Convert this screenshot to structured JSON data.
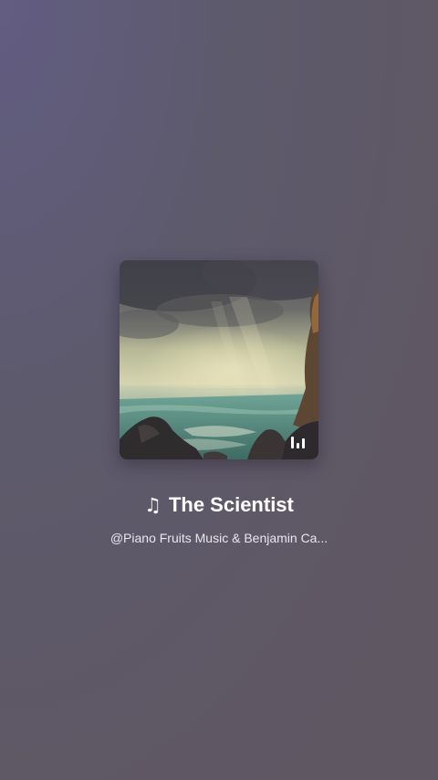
{
  "track": {
    "note_icon": "♫",
    "title": "The Scientist",
    "artist": "@Piano Fruits Music & Benjamin Ca..."
  },
  "artwork": {
    "icon": "playing-bars-icon"
  },
  "colors": {
    "title": "#ffffff",
    "artist": "#e9e6ef"
  }
}
